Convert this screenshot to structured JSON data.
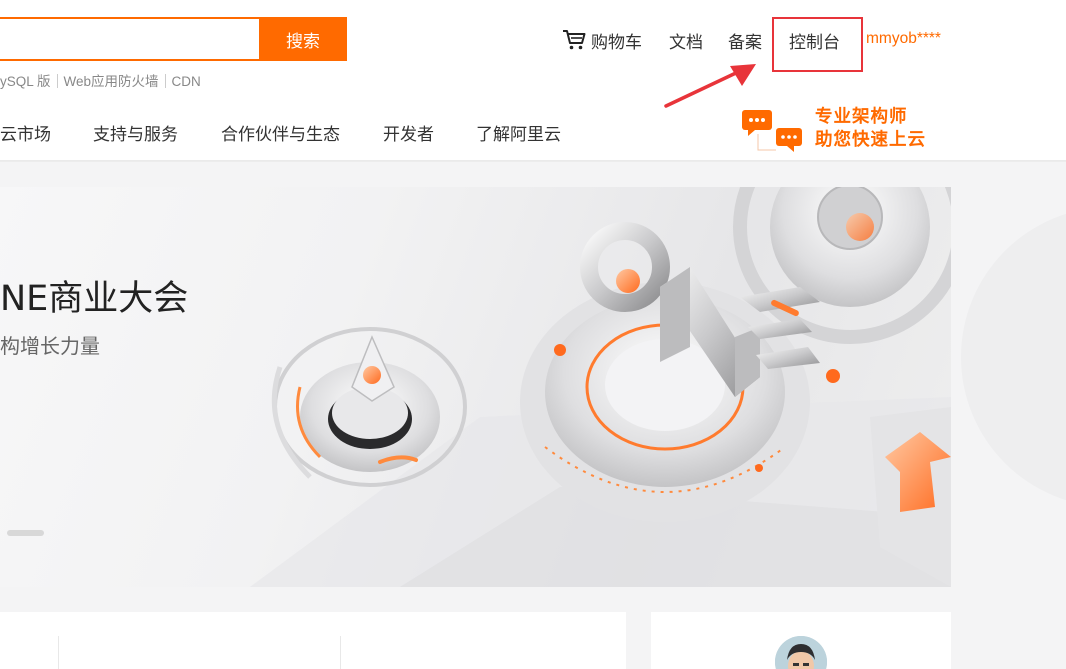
{
  "search": {
    "value": "",
    "button_label": "搜索",
    "hot_words": [
      "ySQL 版",
      "Web应用防火墙",
      "CDN"
    ]
  },
  "topnav": {
    "cart": "购物车",
    "docs": "文档",
    "record": "备案",
    "console": "控制台",
    "user": "mmyob****"
  },
  "mainnav": {
    "items": [
      "云市场",
      "支持与服务",
      "合作伙伴与生态",
      "开发者",
      "了解阿里云"
    ]
  },
  "promo": {
    "line1": "专业架构师",
    "line2": "助您快速上云"
  },
  "banner": {
    "title": "NE商业大会",
    "subtitle": "构增长力量",
    "art_text": "ONE"
  },
  "colors": {
    "accent": "#ff6a00",
    "highlight": "#e8343a"
  },
  "icons": [
    "cart-icon",
    "chat-bubbles-icon",
    "red-arrow-annotation"
  ]
}
